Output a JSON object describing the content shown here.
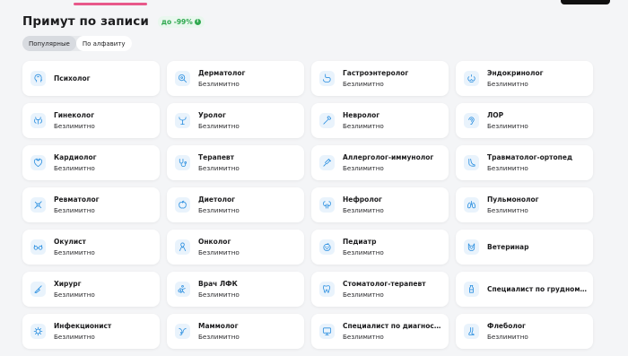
{
  "header": {
    "title": "Примут по записи",
    "discount": "до -99%",
    "discount_icon": "info-icon"
  },
  "tabs": [
    {
      "label": "Популярные",
      "active": true
    },
    {
      "label": "По алфавиту",
      "active": false
    }
  ],
  "colors": {
    "accent": "#e8588a",
    "discount_green": "#2fa84f",
    "icon_blue": "#2b8fe0"
  },
  "specialists": [
    {
      "name": "Психолог",
      "status": "",
      "icon": "head-icon"
    },
    {
      "name": "Дерматолог",
      "status": "Безлимитно",
      "icon": "magnifier-icon"
    },
    {
      "name": "Гастроэнтеролог",
      "status": "Безлимитно",
      "icon": "stomach-icon"
    },
    {
      "name": "Эндокринолог",
      "status": "Безлимитно",
      "icon": "thyroid-icon"
    },
    {
      "name": "Гинеколог",
      "status": "Безлимитно",
      "icon": "uterus-icon"
    },
    {
      "name": "Уролог",
      "status": "Безлимитно",
      "icon": "kidney-icon"
    },
    {
      "name": "Невролог",
      "status": "Безлимитно",
      "icon": "reflex-hammer-icon"
    },
    {
      "name": "ЛОР",
      "status": "Безлимитно",
      "icon": "ear-icon"
    },
    {
      "name": "Кардиолог",
      "status": "Безлимитно",
      "icon": "heart-icon"
    },
    {
      "name": "Терапевт",
      "status": "Безлимитно",
      "icon": "stethoscope-icon"
    },
    {
      "name": "Аллерголог-иммунолог",
      "status": "Безлимитно",
      "icon": "syringe-icon"
    },
    {
      "name": "Травматолог-ортопед",
      "status": "Безлимитно",
      "icon": "foot-icon"
    },
    {
      "name": "Ревматолог",
      "status": "Безлимитно",
      "icon": "joint-icon"
    },
    {
      "name": "Диетолог",
      "status": "Безлимитно",
      "icon": "apple-icon"
    },
    {
      "name": "Нефролог",
      "status": "Безлимитно",
      "icon": "kidneys-icon"
    },
    {
      "name": "Пульмонолог",
      "status": "Безлимитно",
      "icon": "lungs-icon"
    },
    {
      "name": "Окулист",
      "status": "Безлимитно",
      "icon": "glasses-icon"
    },
    {
      "name": "Онколог",
      "status": "Безлимитно",
      "icon": "ribbon-icon"
    },
    {
      "name": "Педиатр",
      "status": "Безлимитно",
      "icon": "baby-icon"
    },
    {
      "name": "Ветеринар",
      "status": "",
      "icon": "cat-icon"
    },
    {
      "name": "Хирург",
      "status": "Безлимитно",
      "icon": "scalpel-icon"
    },
    {
      "name": "Врач ЛФК",
      "status": "Безлимитно",
      "icon": "exercise-icon"
    },
    {
      "name": "Стоматолог-терапевт",
      "status": "Безлимитно",
      "icon": "tooth-icon"
    },
    {
      "name": "Специалист по грудному вс...",
      "status": "",
      "icon": "bottle-icon"
    },
    {
      "name": "Инфекционист",
      "status": "Безлимитно",
      "icon": "virus-icon"
    },
    {
      "name": "Маммолог",
      "status": "Безлимитно",
      "icon": "breast-icon"
    },
    {
      "name": "Специалист по диагностике",
      "status": "Безлимитно",
      "icon": "monitor-icon"
    },
    {
      "name": "Флеболог",
      "status": "Безлимитно",
      "icon": "leg-icon"
    }
  ]
}
